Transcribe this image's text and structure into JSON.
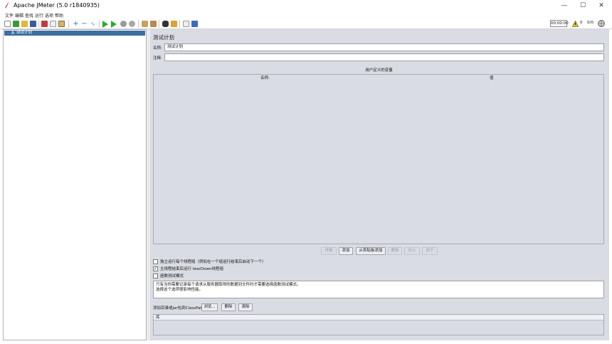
{
  "window": {
    "title": "Apache JMeter (5.0 r1840935)",
    "controls": {
      "minimize": "—",
      "maximize": "☐",
      "close": "✕"
    }
  },
  "menubar": {
    "items": [
      "文件",
      "编辑",
      "查找",
      "运行",
      "选项",
      "帮助"
    ]
  },
  "toolbar": {
    "timer": "00:00:00",
    "warning_count": "0",
    "thread_count": "0/0"
  },
  "tree": {
    "root": {
      "icon": "A",
      "label": "测试计划"
    }
  },
  "panel": {
    "title": "测试计划",
    "name_label": "名称:",
    "name_value": "测试计划",
    "comment_label": "注释:",
    "comment_value": "",
    "vars_caption": "用户定义的变量",
    "vars_columns": [
      "名称:",
      "值"
    ],
    "vars_buttons": {
      "detail": "详细",
      "add": "添加",
      "add_clipboard": "从剪贴板添加",
      "delete": "删除",
      "up": "向上",
      "down": "向下"
    },
    "options": [
      {
        "label": "独立运行每个线程组（例如在一个组运行结束后启动下一个）",
        "checked": false
      },
      {
        "label": "主线程结束后运行 tearDown线程组",
        "checked": true
      },
      {
        "label": "函数测试模式",
        "checked": false
      }
    ],
    "note_lines": [
      "只有当你需要记录每个请求从服务器取得的数据到文件时才需要选择函数测试模式。",
      "选择这个选项很影响性能。"
    ],
    "classpath_label": "添加目录或jar包到ClassPath",
    "classpath_buttons": {
      "browse": "浏览...",
      "delete": "删除",
      "clear": "清除"
    },
    "classpath_column": "库"
  }
}
